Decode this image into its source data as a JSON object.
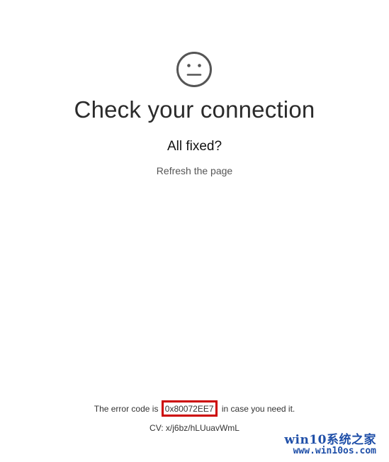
{
  "page": {
    "face_icon": "neutral-face-icon",
    "title": "Check your connection",
    "subtitle": "All fixed?",
    "refresh_link": "Refresh the page"
  },
  "error": {
    "prefix": "The error code is",
    "code": "0x80072EE7",
    "suffix": "in case you need it.",
    "highlight_color": "#cc0000"
  },
  "cv": {
    "text": "CV: x/j6bz/hLUuavWmL"
  },
  "watermark": {
    "line1": "win10系统之家",
    "line2": "www.win10os.com",
    "color": "#1f4fa8"
  }
}
